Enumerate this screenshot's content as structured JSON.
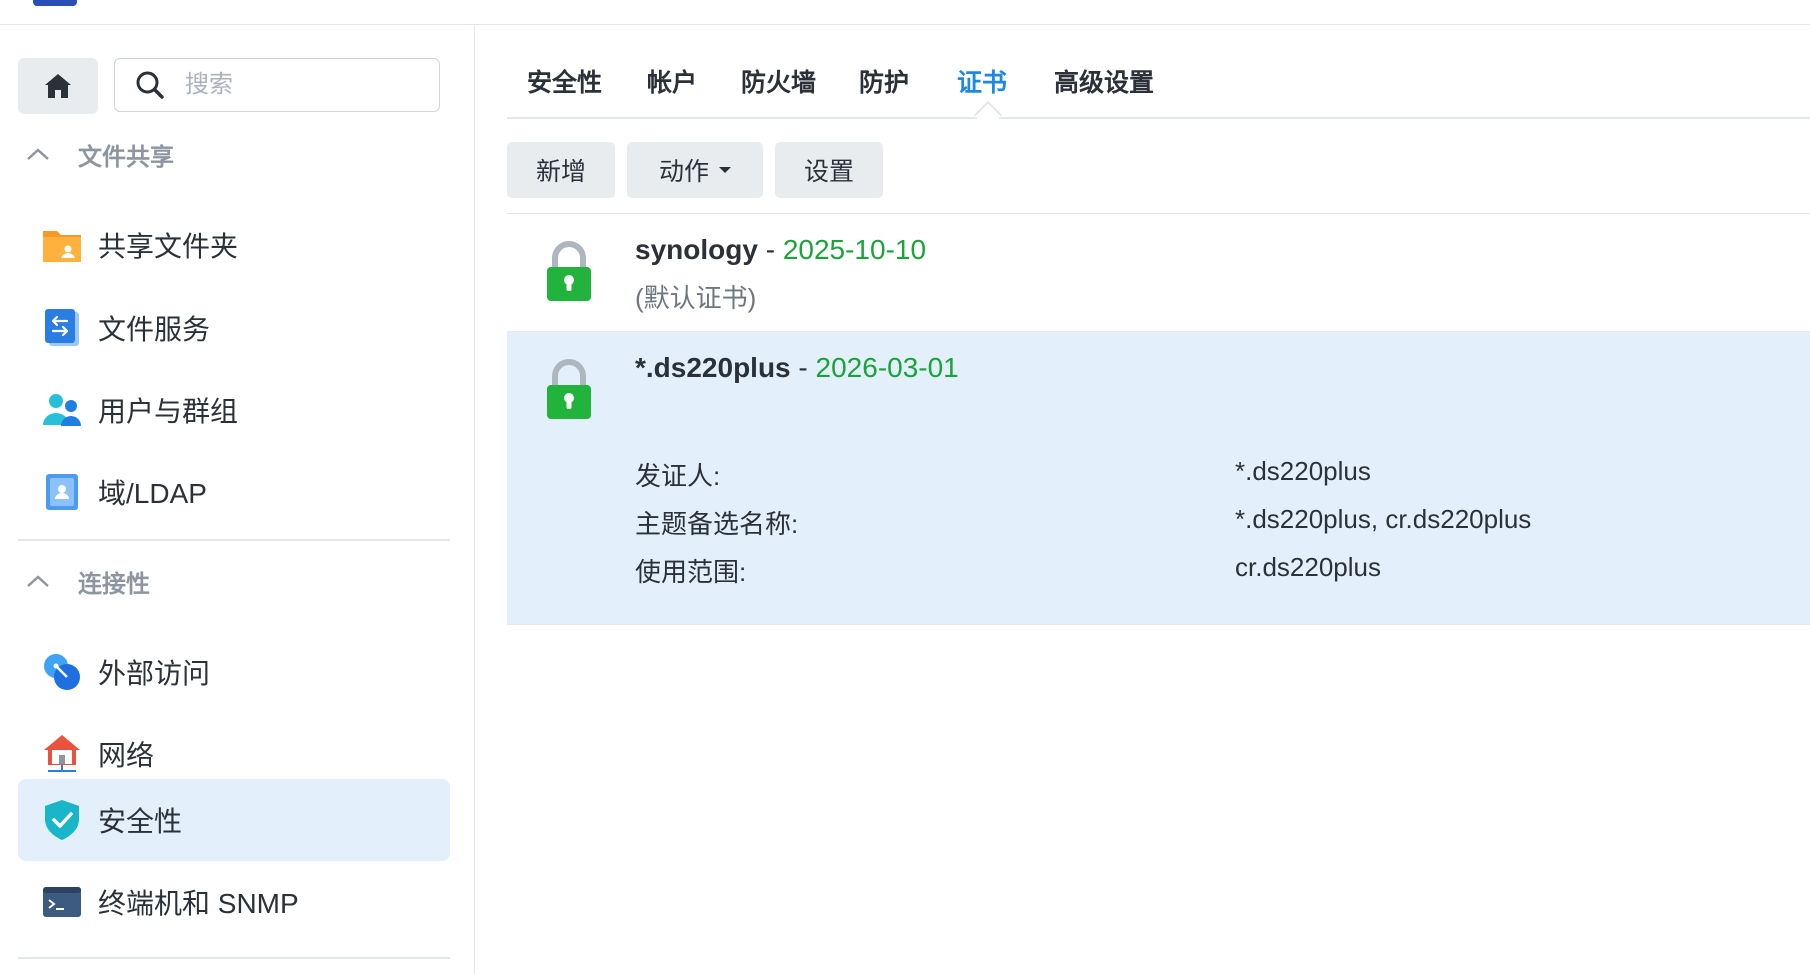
{
  "sidebar": {
    "search_placeholder": "搜索",
    "sections": [
      {
        "title": "文件共享",
        "items": [
          {
            "label": "共享文件夹",
            "icon": "shared-folder-icon"
          },
          {
            "label": "文件服务",
            "icon": "file-services-icon"
          },
          {
            "label": "用户与群组",
            "icon": "user-group-icon"
          },
          {
            "label": "域/LDAP",
            "icon": "domain-ldap-icon"
          }
        ]
      },
      {
        "title": "连接性",
        "items": [
          {
            "label": "外部访问",
            "icon": "external-access-icon"
          },
          {
            "label": "网络",
            "icon": "network-icon"
          },
          {
            "label": "安全性",
            "icon": "security-shield-icon",
            "active": true
          },
          {
            "label": "终端机和 SNMP",
            "icon": "terminal-icon"
          }
        ]
      }
    ]
  },
  "tabs": [
    {
      "label": "安全性"
    },
    {
      "label": "帐户"
    },
    {
      "label": "防火墙"
    },
    {
      "label": "防护"
    },
    {
      "label": "证书",
      "active": true
    },
    {
      "label": "高级设置"
    }
  ],
  "toolbar": {
    "add_label": "新增",
    "action_label": "动作",
    "settings_label": "设置"
  },
  "certificates": [
    {
      "name": "synology",
      "separator": " - ",
      "date": "2025-10-10",
      "note": "(默认证书)",
      "selected": false
    },
    {
      "name": "*.ds220plus",
      "separator": " - ",
      "date": "2026-03-01",
      "selected": true,
      "details": [
        {
          "key": "发证人:",
          "value": "*.ds220plus"
        },
        {
          "key": "主题备选名称:",
          "value": "*.ds220plus, cr.ds220plus"
        },
        {
          "key": "使用范围:",
          "value": "cr.ds220plus"
        }
      ]
    }
  ],
  "colors": {
    "accent": "#1e88e5",
    "date_green": "#1aa33a",
    "lock_green": "#22b33d",
    "selected_bg": "#e3f0fb"
  }
}
